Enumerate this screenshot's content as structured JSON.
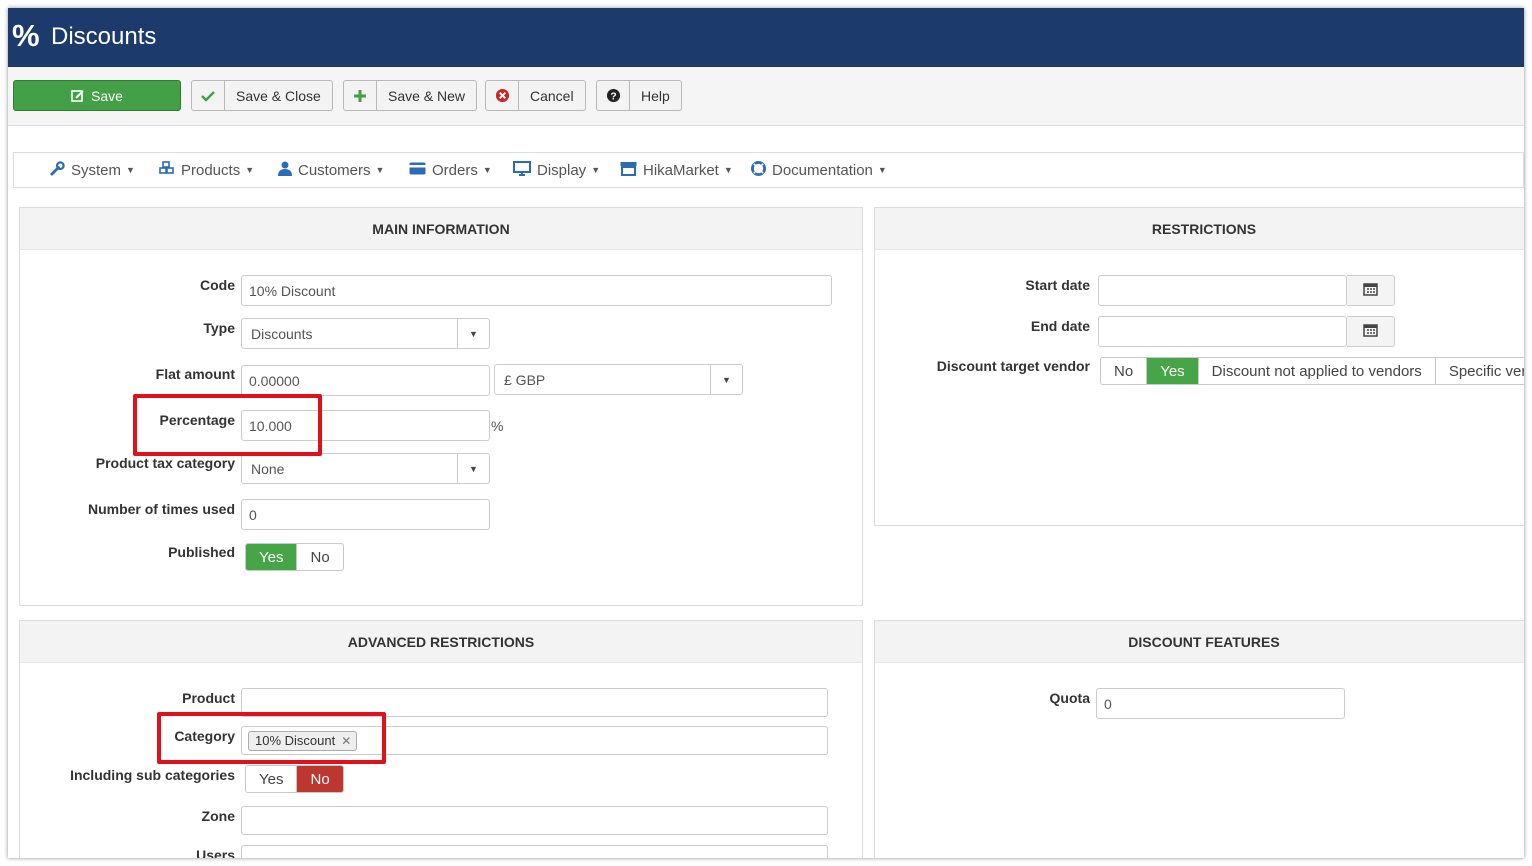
{
  "app": {
    "title": "Discounts",
    "title_icon": "percent-icon",
    "header_color": "#1c3a6b"
  },
  "toolbar": {
    "save": "Save",
    "save_close": "Save & Close",
    "save_new": "Save & New",
    "cancel": "Cancel",
    "help": "Help"
  },
  "menu": {
    "items": [
      {
        "label": "System",
        "icon": "wrench-icon"
      },
      {
        "label": "Products",
        "icon": "cubes-icon"
      },
      {
        "label": "Customers",
        "icon": "user-icon"
      },
      {
        "label": "Orders",
        "icon": "credit-card-icon"
      },
      {
        "label": "Display",
        "icon": "monitor-icon"
      },
      {
        "label": "HikaMarket",
        "icon": "store-icon"
      },
      {
        "label": "Documentation",
        "icon": "lifebuoy-icon"
      }
    ]
  },
  "main_info": {
    "heading": "MAIN INFORMATION",
    "code_label": "Code",
    "code_value": "10% Discount",
    "type_label": "Type",
    "type_value": "Discounts",
    "flat_label": "Flat amount",
    "flat_value": "0.00000",
    "currency_value": "£ GBP",
    "percentage_label": "Percentage",
    "percentage_value": "10.000",
    "percentage_suffix": "%",
    "tax_label": "Product tax category",
    "tax_value": "None",
    "used_label": "Number of times used",
    "used_value": "0",
    "published_label": "Published",
    "published_yes": "Yes",
    "published_no": "No",
    "published_selected": "Yes"
  },
  "restrictions": {
    "heading": "RESTRICTIONS",
    "start_label": "Start date",
    "start_value": "",
    "end_label": "End date",
    "end_value": "",
    "vendor_label": "Discount target vendor",
    "vendor_options": [
      "No",
      "Yes",
      "Discount not applied to vendors",
      "Specific ven"
    ],
    "vendor_selected": "Yes"
  },
  "advanced": {
    "heading": "ADVANCED RESTRICTIONS",
    "product_label": "Product",
    "category_label": "Category",
    "category_tag": "10% Discount",
    "subcat_label": "Including sub categories",
    "subcat_yes": "Yes",
    "subcat_no": "No",
    "subcat_selected": "No",
    "zone_label": "Zone",
    "users_label": "Users"
  },
  "features": {
    "heading": "DISCOUNT FEATURES",
    "quota_label": "Quota",
    "quota_value": "0"
  },
  "colors": {
    "green": "#46a546",
    "red": "#bd362f",
    "highlight": "#e0111b"
  }
}
